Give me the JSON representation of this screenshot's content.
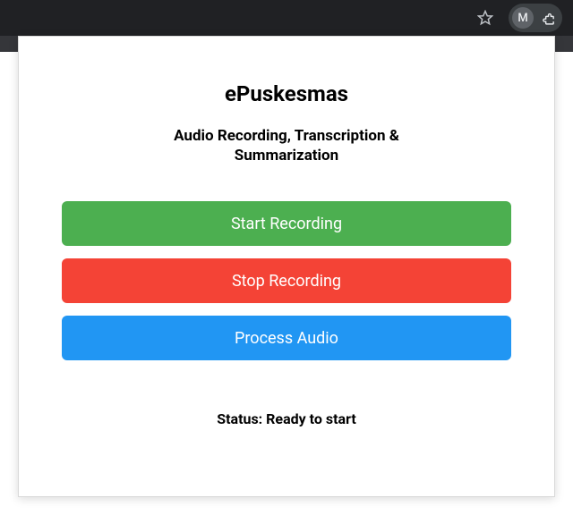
{
  "browser": {
    "avatar_letter": "M"
  },
  "popup": {
    "title": "ePuskesmas",
    "subtitle": "Audio Recording, Transcription & Summarization",
    "buttons": {
      "start": "Start Recording",
      "stop": "Stop Recording",
      "process": "Process Audio"
    },
    "status_label": "Status:",
    "status_value": "Ready to start"
  },
  "colors": {
    "start_button": "#4caf50",
    "stop_button": "#f44336",
    "process_button": "#2196f3"
  }
}
